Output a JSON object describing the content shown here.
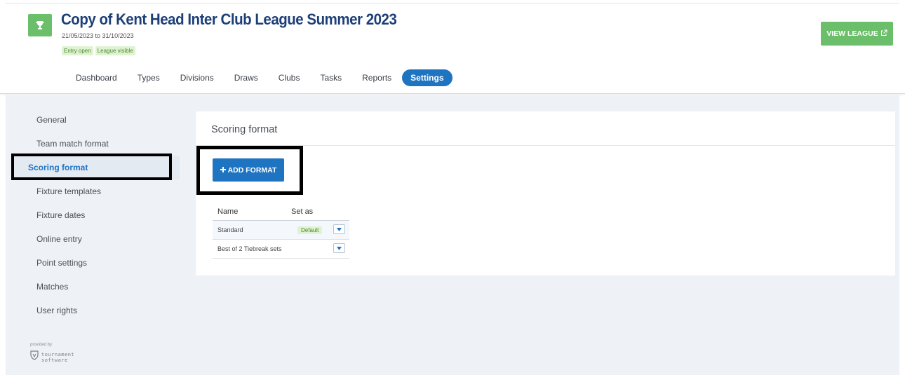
{
  "header": {
    "title": "Copy of Kent Head Inter Club League Summer 2023",
    "dates": "21/05/2023 to 31/10/2023",
    "badges": [
      "Entry open",
      "League visible"
    ],
    "view_league_label": "VIEW LEAGUE",
    "view_league_icon": "external-link-icon",
    "trophy_icon": "trophy-icon"
  },
  "tabs": [
    {
      "label": "Dashboard"
    },
    {
      "label": "Types"
    },
    {
      "label": "Divisions"
    },
    {
      "label": "Draws"
    },
    {
      "label": "Clubs"
    },
    {
      "label": "Tasks"
    },
    {
      "label": "Reports"
    },
    {
      "label": "Settings",
      "active": true
    }
  ],
  "sidebar": {
    "items": [
      {
        "label": "General"
      },
      {
        "label": "Team match format"
      },
      {
        "label": "Scoring format",
        "active": true
      },
      {
        "label": "Fixture templates"
      },
      {
        "label": "Fixture dates"
      },
      {
        "label": "Online entry"
      },
      {
        "label": "Point settings"
      },
      {
        "label": "Matches"
      },
      {
        "label": "User rights"
      }
    ],
    "provided_by": "provided by",
    "logo_line1": "tournament",
    "logo_line2": "software"
  },
  "main": {
    "title": "Scoring format",
    "add_button_label": "ADD FORMAT",
    "table": {
      "columns": [
        "Name",
        "Set as"
      ],
      "rows": [
        {
          "name": "Standard",
          "set_as": "Default"
        },
        {
          "name": "Best of 2 Tiebreak sets",
          "set_as": ""
        }
      ]
    }
  },
  "colors": {
    "accent_blue": "#1f74c2",
    "title_navy": "#1d3f77",
    "green": "#6cbf6a",
    "annotation": "#000000"
  }
}
